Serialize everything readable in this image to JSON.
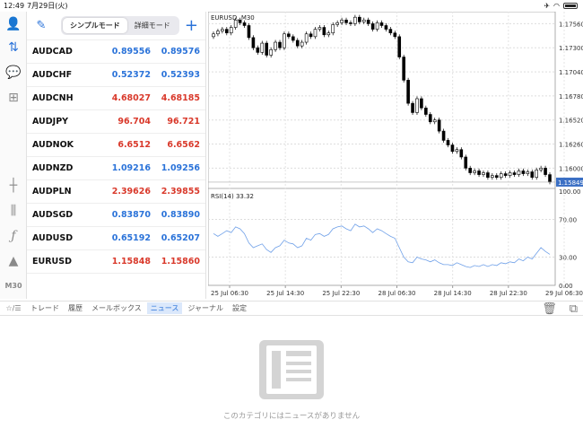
{
  "status": {
    "time": "12:49",
    "date": "7月29日(火)"
  },
  "sidebar": {
    "items": [
      "account-icon",
      "trade-icon",
      "chat-icon",
      "plus-doc-icon",
      "crosshair-icon",
      "candles-icon",
      "function-icon",
      "objects-icon"
    ],
    "timeframe": "M30"
  },
  "quotes": {
    "segments": [
      "シンプルモード",
      "詳細モード"
    ],
    "rows": [
      {
        "symbol": "AUDCAD",
        "bid": "0.89556",
        "ask": "0.89576",
        "dir": "up"
      },
      {
        "symbol": "AUDCHF",
        "bid": "0.52372",
        "ask": "0.52393",
        "dir": "up"
      },
      {
        "symbol": "AUDCNH",
        "bid": "4.68027",
        "ask": "4.68185",
        "dir": "dn"
      },
      {
        "symbol": "AUDJPY",
        "bid": "96.704",
        "ask": "96.721",
        "dir": "dn"
      },
      {
        "symbol": "AUDNOK",
        "bid": "6.6512",
        "ask": "6.6562",
        "dir": "dn"
      },
      {
        "symbol": "AUDNZD",
        "bid": "1.09216",
        "ask": "1.09256",
        "dir": "up"
      },
      {
        "symbol": "AUDPLN",
        "bid": "2.39626",
        "ask": "2.39855",
        "dir": "dn"
      },
      {
        "symbol": "AUDSGD",
        "bid": "0.83870",
        "ask": "0.83890",
        "dir": "up"
      },
      {
        "symbol": "AUDUSD",
        "bid": "0.65192",
        "ask": "0.65207",
        "dir": "up"
      },
      {
        "symbol": "EURUSD",
        "bid": "1.15848",
        "ask": "1.15860",
        "dir": "dn"
      }
    ]
  },
  "chart": {
    "title": "EURUSD, M30",
    "price_ticks": [
      "1.17560",
      "1.17300",
      "1.17040",
      "1.16780",
      "1.16520",
      "1.16260",
      "1.16000"
    ],
    "current_price": "1.15849",
    "rsi_label": "RSI(14) 33.32",
    "rsi_ticks": [
      "100.00",
      "70.00",
      "30.00",
      "0.00"
    ],
    "time_ticks": [
      "25 Jul 06:30",
      "25 Jul 14:30",
      "25 Jul 22:30",
      "28 Jul 06:30",
      "28 Jul 14:30",
      "28 Jul 22:30",
      "29 Jul 06:30"
    ],
    "closes": [
      1.1745,
      1.1748,
      1.175,
      1.1746,
      1.1752,
      1.176,
      1.1757,
      1.1754,
      1.1741,
      1.173,
      1.1725,
      1.1735,
      1.1722,
      1.1728,
      1.1736,
      1.173,
      1.1745,
      1.1742,
      1.1738,
      1.1732,
      1.1736,
      1.1745,
      1.1742,
      1.175,
      1.1752,
      1.1744,
      1.1746,
      1.1755,
      1.1757,
      1.176,
      1.1757,
      1.1756,
      1.1763,
      1.1758,
      1.176,
      1.1756,
      1.175,
      1.1757,
      1.1754,
      1.175,
      1.1746,
      1.1742,
      1.172,
      1.1695,
      1.167,
      1.166,
      1.1675,
      1.1665,
      1.1658,
      1.165,
      1.1652,
      1.164,
      1.163,
      1.1625,
      1.1618,
      1.162,
      1.1612,
      1.16,
      1.1595,
      1.1597,
      1.1593,
      1.1595,
      1.159,
      1.1592,
      1.159,
      1.1594,
      1.1592,
      1.1595,
      1.1593,
      1.1597,
      1.1594,
      1.1596,
      1.159,
      1.1598,
      1.16,
      1.1593,
      1.1585
    ],
    "rsi": [
      55,
      52,
      55,
      58,
      56,
      62,
      60,
      55,
      45,
      40,
      42,
      44,
      38,
      35,
      40,
      42,
      48,
      45,
      44,
      40,
      42,
      50,
      48,
      54,
      55,
      52,
      54,
      60,
      62,
      63,
      60,
      58,
      65,
      62,
      63,
      60,
      56,
      60,
      58,
      55,
      52,
      50,
      40,
      30,
      25,
      24,
      30,
      28,
      27,
      25,
      27,
      24,
      22,
      22,
      21,
      24,
      22,
      20,
      19,
      21,
      20,
      22,
      20,
      22,
      21,
      24,
      23,
      25,
      24,
      28,
      26,
      30,
      28,
      34,
      40,
      36,
      33
    ]
  },
  "tabs": [
    "トレード",
    "履歴",
    "メールボックス",
    "ニュース",
    "ジャーナル",
    "設定"
  ],
  "active_tab": "ニュース",
  "tabs_filter": "☆/☰",
  "empty_message": "このカテゴリにはニュースがありません"
}
